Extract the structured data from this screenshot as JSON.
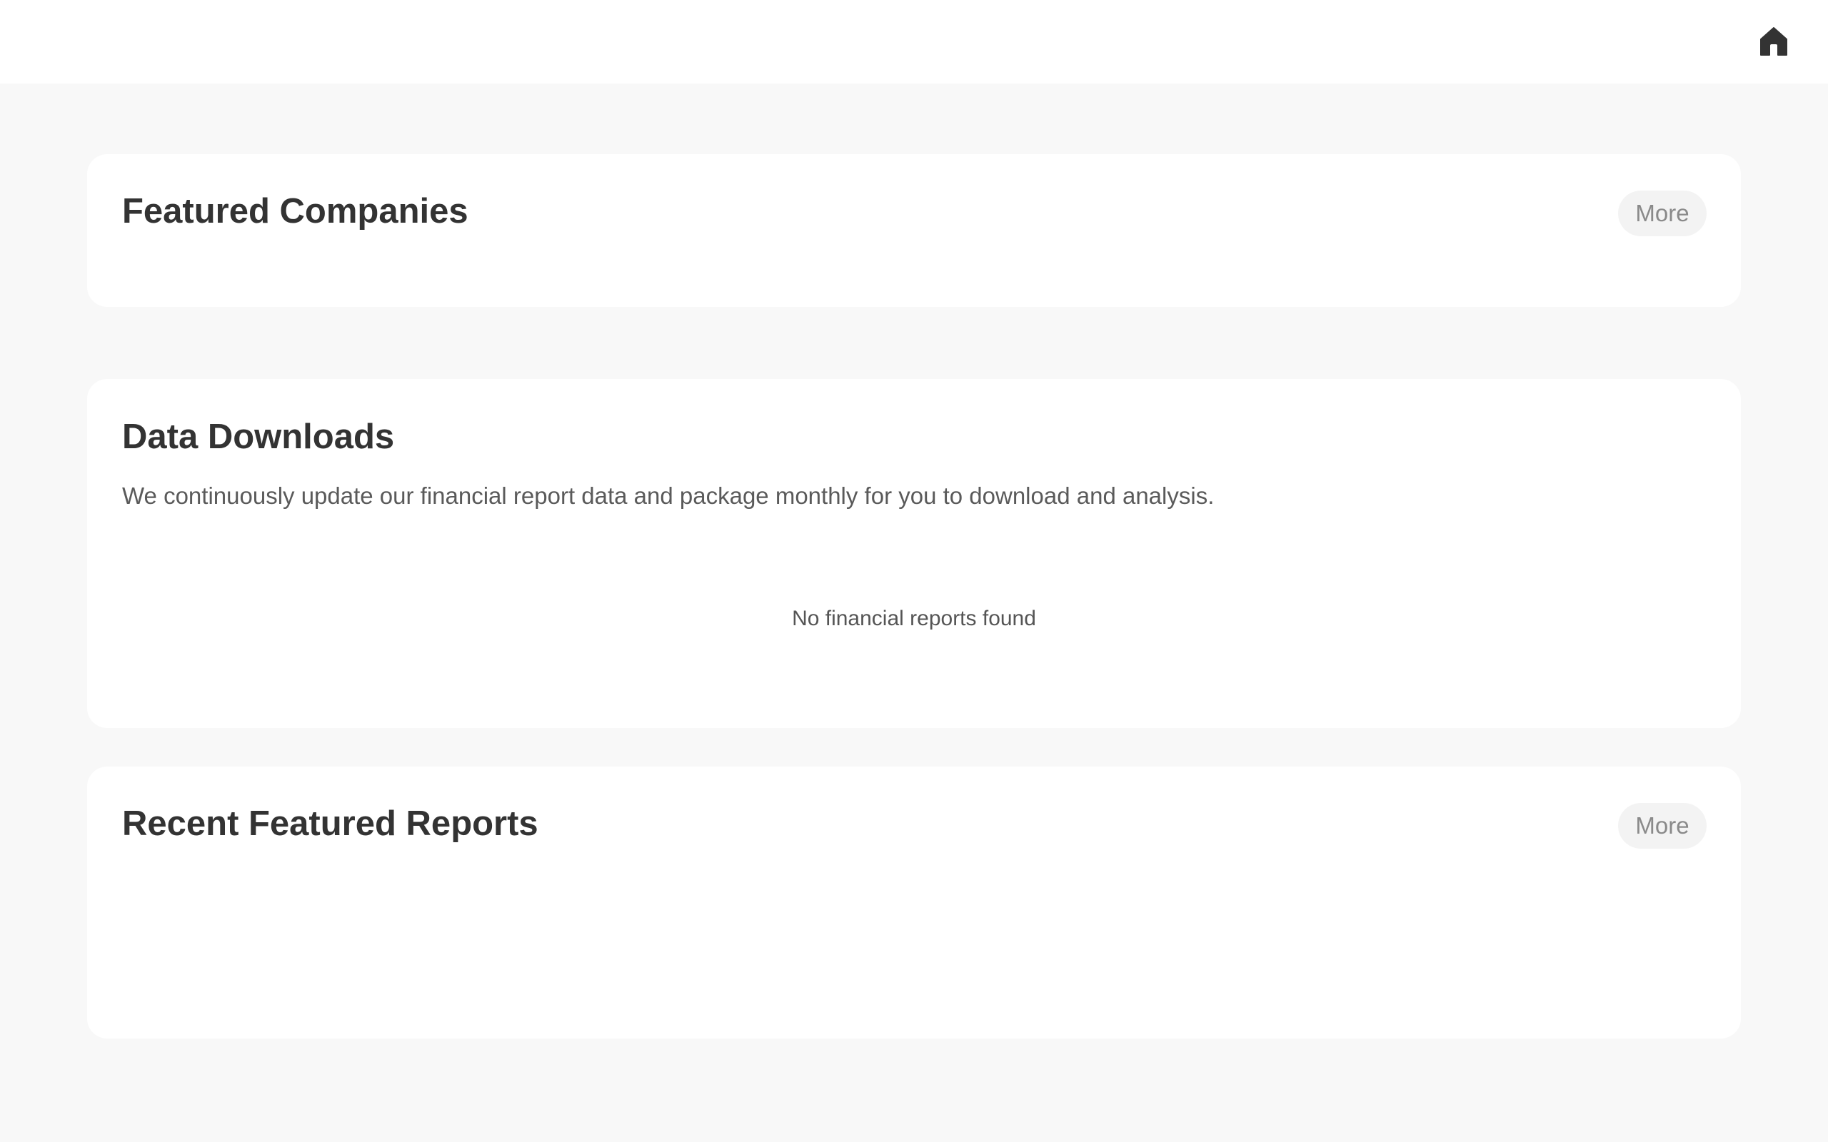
{
  "header": {
    "home_icon": "home-icon"
  },
  "featured_companies": {
    "title": "Featured Companies",
    "more_label": "More"
  },
  "data_downloads": {
    "title": "Data Downloads",
    "description": "We continuously update our financial report data and package monthly for you to download and analysis.",
    "empty_message": "No financial reports found"
  },
  "recent_featured_reports": {
    "title": "Recent Featured Reports",
    "more_label": "More"
  },
  "colors": {
    "page_background": "#f8f8f8",
    "card_background": "#ffffff",
    "heading_text": "#333333",
    "more_button_background": "#f3f3f3",
    "more_button_text": "#8a8a8a"
  }
}
